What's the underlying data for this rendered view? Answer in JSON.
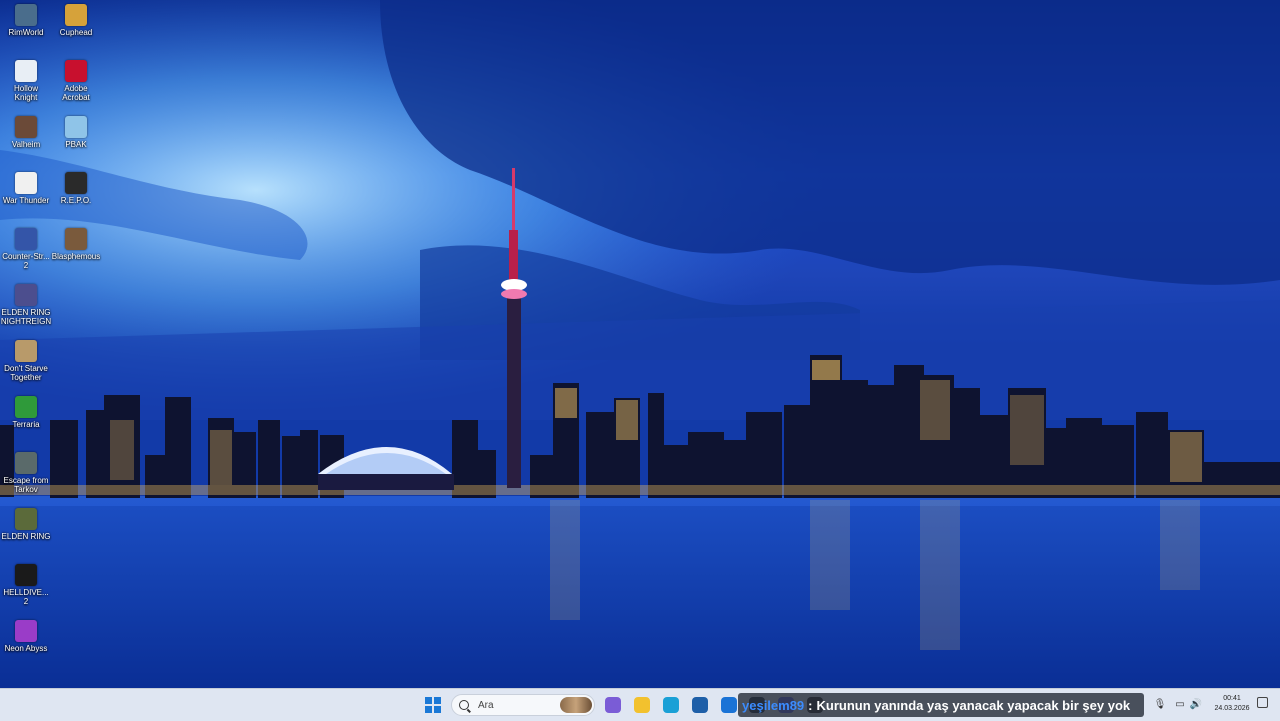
{
  "desktop_icons": [
    {
      "label": "RimWorld",
      "icon": "rimworld-icon",
      "color": "#4a6d8c"
    },
    {
      "label": "Cuphead",
      "icon": "cuphead-icon",
      "color": "#d6a23a"
    },
    {
      "label": "Hollow\nKnight",
      "icon": "hollow-knight-icon",
      "color": "#e8eef5"
    },
    {
      "label": "Adobe\nAcrobat",
      "icon": "acrobat-icon",
      "color": "#c8102e"
    },
    {
      "label": "Valheim",
      "icon": "valheim-icon",
      "color": "#6b4a38"
    },
    {
      "label": "PBAK",
      "icon": "pbak-icon",
      "color": "#8fc4e8"
    },
    {
      "label": "War Thunder",
      "icon": "war-thunder-icon",
      "color": "#f0f0f0"
    },
    {
      "label": "R.E.P.O.",
      "icon": "repo-icon",
      "color": "#2a2a2a"
    },
    {
      "label": "Counter-Str...\n2",
      "icon": "counter-strike-icon",
      "color": "#3455a8"
    },
    {
      "label": "Blasphemous",
      "icon": "blasphemous-icon",
      "color": "#7a5a3c"
    },
    {
      "label": "ELDEN RING\nNIGHTREIGN",
      "icon": "elden-ring-nightreign-icon",
      "color": "#4c4e8e"
    },
    {
      "label": "Don't Starve\nTogether",
      "icon": "dont-starve-icon",
      "color": "#b89a6a"
    },
    {
      "label": "Terraria",
      "icon": "terraria-icon",
      "color": "#2f9a3a"
    },
    {
      "label": "Escape from\nTarkov",
      "icon": "tarkov-icon",
      "color": "#5a6a6a"
    },
    {
      "label": "ELDEN RING",
      "icon": "elden-ring-icon",
      "color": "#5b6a3a"
    },
    {
      "label": "HELLDIVE...\n2",
      "icon": "helldivers-icon",
      "color": "#1a1a1a"
    },
    {
      "label": "Neon Abyss",
      "icon": "neon-abyss-icon",
      "color": "#9a3cc8"
    }
  ],
  "taskbar": {
    "search_placeholder": "Ara",
    "news_user": "yeşilem89",
    "news_separator": ":",
    "news_text": "Kurunun yanında yaş yanacak yapacak bir şey yok",
    "clock_time": "00:41",
    "clock_date": "24.03.2026",
    "pinned": [
      {
        "icon": "copilot-icon",
        "color": "#7a5cd6"
      },
      {
        "icon": "file-explorer-icon",
        "color": "#f2c12e"
      },
      {
        "icon": "edge-icon",
        "color": "#1aa0d6"
      },
      {
        "icon": "store-icon",
        "color": "#1e5fa8"
      },
      {
        "icon": "outlook-icon",
        "color": "#1a73d6"
      },
      {
        "icon": "steam-icon",
        "color": "#1b2838"
      },
      {
        "icon": "discord-icon",
        "color": "#5865f2"
      },
      {
        "icon": "obs-icon",
        "color": "#222222"
      }
    ]
  }
}
